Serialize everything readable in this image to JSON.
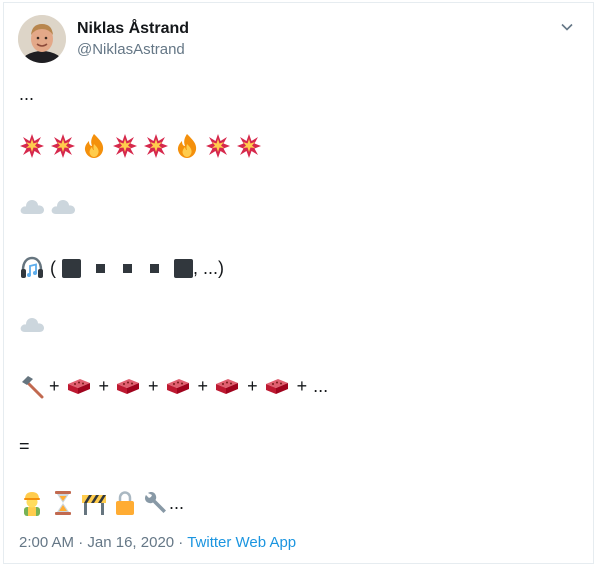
{
  "author": {
    "name": "Niklas Åstrand",
    "handle": "@NiklasAstrand"
  },
  "menu": {
    "icon": "chevron-down-icon"
  },
  "tweet": {
    "line1": "...",
    "line2_icons": [
      "collision-icon",
      "collision-icon",
      "fire-icon",
      "collision-icon",
      "collision-icon",
      "fire-icon",
      "collision-icon",
      "collision-icon"
    ],
    "line3_icons": [
      "cloud-icon",
      "cloud-icon"
    ],
    "line4_open": "(",
    "line4_close": ", ...)",
    "line5_icons": [
      "cloud-icon"
    ],
    "line6_plus": "+",
    "line6_tail": "...",
    "line7": "=",
    "line8_icons": [
      "construction-worker-icon",
      "hourglass-icon",
      "barrier-icon",
      "lock-icon",
      "wrench-icon"
    ],
    "line8_tail": "..."
  },
  "footer": {
    "time": "2:00 AM",
    "sep": " · ",
    "date": "Jan 16, 2020",
    "source": "Twitter Web App"
  },
  "colors": {
    "text": "#14171a",
    "muted": "#657786",
    "link": "#1b95e0",
    "border": "#e6ecf0"
  }
}
